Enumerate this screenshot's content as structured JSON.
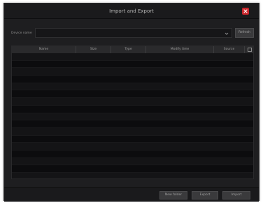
{
  "dialog": {
    "title": "Import and Export"
  },
  "device": {
    "label": "Device name",
    "value": "",
    "refresh_label": "Refresh"
  },
  "table": {
    "columns": [
      "Name",
      "Size",
      "Type",
      "Modify time",
      "Source"
    ],
    "rows": []
  },
  "footer": {
    "buttons": [
      "New folder",
      "Export",
      "Import"
    ]
  },
  "colors": {
    "close": "#c8252b",
    "background": "#1e1e20"
  }
}
